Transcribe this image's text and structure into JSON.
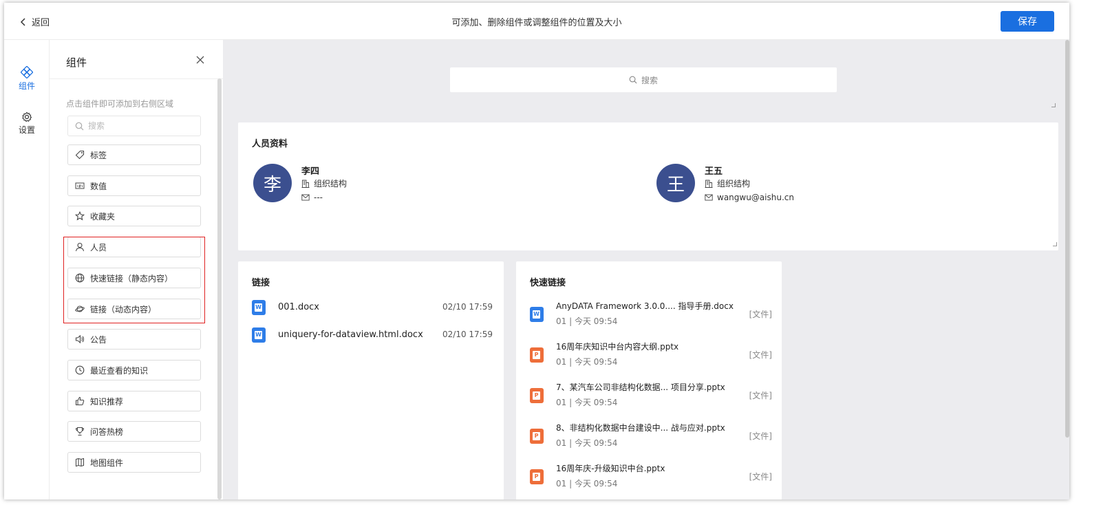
{
  "header": {
    "back_label": "返回",
    "hint": "可添加、删除组件或调整组件的位置及大小",
    "save_label": "保存"
  },
  "rail": {
    "items": [
      {
        "label": "组件",
        "icon": "component-icon",
        "active": true
      },
      {
        "label": "设置",
        "icon": "gear-icon",
        "active": false
      }
    ]
  },
  "panel": {
    "title": "组件",
    "hint": "点击组件即可添加到右侧区域",
    "search_placeholder": "搜索",
    "components": [
      {
        "label": "标签",
        "icon": "tag-icon"
      },
      {
        "label": "数值",
        "icon": "number-icon"
      },
      {
        "label": "收藏夹",
        "icon": "star-icon"
      },
      {
        "label": "人员",
        "icon": "user-icon"
      },
      {
        "label": "快速链接（静态内容）",
        "icon": "globe-icon"
      },
      {
        "label": "链接（动态内容）",
        "icon": "planet-icon"
      },
      {
        "label": "公告",
        "icon": "speaker-icon"
      },
      {
        "label": "最近查看的知识",
        "icon": "clock-icon"
      },
      {
        "label": "知识推荐",
        "icon": "thumbs-up-icon"
      },
      {
        "label": "问答热榜",
        "icon": "trophy-icon"
      },
      {
        "label": "地图组件",
        "icon": "map-icon"
      }
    ]
  },
  "canvas": {
    "search_placeholder": "搜索",
    "people_card": {
      "title": "人员资料",
      "people": [
        {
          "avatar": "李",
          "name": "李四",
          "org": "组织结构",
          "email": "---"
        },
        {
          "avatar": "王",
          "name": "王五",
          "org": "组织结构",
          "email": "wangwu@aishu.cn"
        }
      ]
    },
    "links_card": {
      "title": "链接",
      "items": [
        {
          "name": "001.docx",
          "time": "02/10 17:59",
          "type": "word"
        },
        {
          "name": "uniquery-for-dataview.html.docx",
          "time": "02/10 17:59",
          "type": "word"
        }
      ]
    },
    "quick_links_card": {
      "title": "快速链接",
      "items": [
        {
          "name": "AnyDATA Framework 3.0.0.... 指导手册.docx",
          "meta": "01  |  今天 09:54",
          "tag": "[文件]",
          "type": "word"
        },
        {
          "name": "16周年庆知识中台内容大纲.pptx",
          "meta": "01  |  今天 09:54",
          "tag": "[文件]",
          "type": "ppt"
        },
        {
          "name": "7、某汽车公司非结构化数据... 项目分享.pptx",
          "meta": "01  |  今天 09:54",
          "tag": "[文件]",
          "type": "ppt"
        },
        {
          "name": "8、非结构化数据中台建设中... 战与应对.pptx",
          "meta": "01  |  今天 09:54",
          "tag": "[文件]",
          "type": "ppt"
        },
        {
          "name": "16周年庆-升级知识中台.pptx",
          "meta": "01  |  今天 09:54",
          "tag": "[文件]",
          "type": "ppt"
        }
      ]
    }
  },
  "colors": {
    "accent": "#1a6fe0",
    "highlight": "#e02020",
    "avatar": "#3b4f8f",
    "word": "#2e7de8",
    "ppt": "#ee6e3a"
  }
}
